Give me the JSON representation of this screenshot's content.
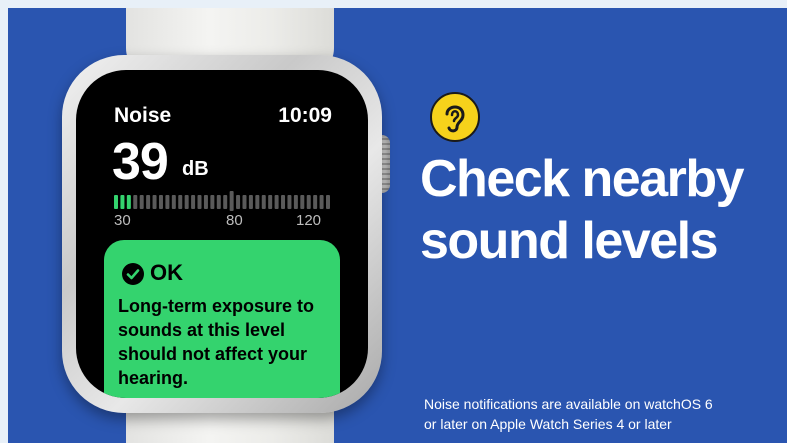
{
  "watch": {
    "app_title": "Noise",
    "time": "10:09",
    "level_value": "39",
    "level_unit": "dB",
    "meter_level_db": 39,
    "meter_range_db": [
      30,
      120
    ],
    "scale_labels": [
      "30",
      "80",
      "120"
    ],
    "status": {
      "icon": "checkmark-circle-icon",
      "label": "OK",
      "message": "Long-term exposure to sounds at this level should not affect your hearing."
    }
  },
  "promo": {
    "icon": "ear-icon",
    "headline_line1": "Check nearby",
    "headline_line2": "sound levels",
    "footnote_line1": "Noise notifications are available on watchOS 6",
    "footnote_line2": "or later on Apple Watch Series 4 or later"
  },
  "colors": {
    "background": "#2a55b0",
    "ok_green": "#34d36e",
    "meter_active": "#34d36e",
    "meter_inactive": "#5a5a5a",
    "ear_yellow": "#f6d21b"
  }
}
